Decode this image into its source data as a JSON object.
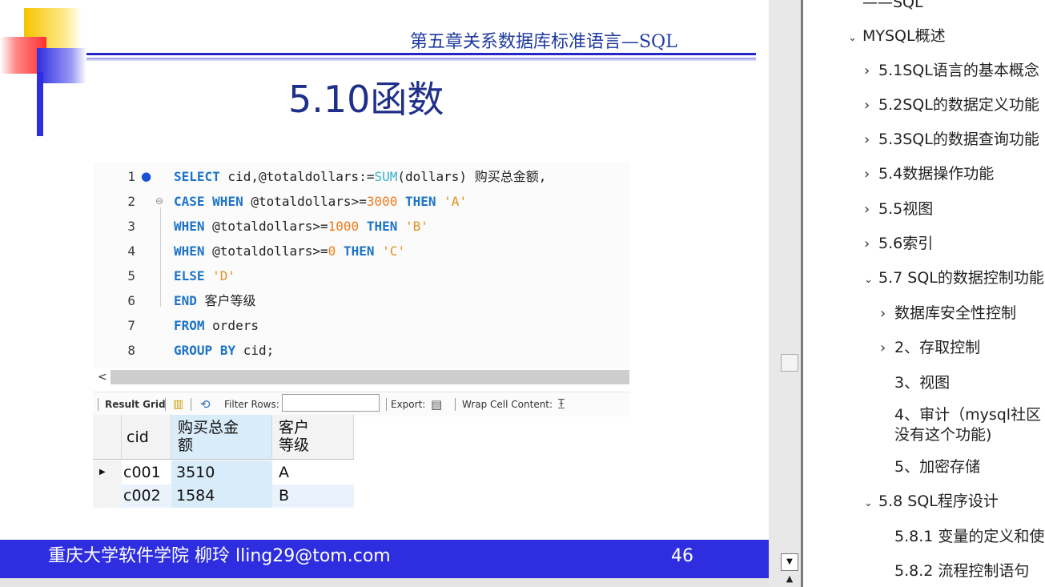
{
  "slide": {
    "chapter_title": "第五章关系数据库标准语言—SQL",
    "title": "5.10函数",
    "footer_text": "重庆大学软件学院 柳玲 lling29@tom.com",
    "page_number": "46"
  },
  "code": {
    "lines": [
      {
        "num": "1",
        "text": "SELECT cid,@totaldollars:=SUM(dollars) 购买总金额,"
      },
      {
        "num": "2",
        "text": "CASE WHEN @totaldollars>=3000 THEN 'A'"
      },
      {
        "num": "3",
        "text": "WHEN @totaldollars>=1000 THEN 'B'"
      },
      {
        "num": "4",
        "text": "WHEN @totaldollars>=0 THEN 'C'"
      },
      {
        "num": "5",
        "text": "ELSE 'D'"
      },
      {
        "num": "6",
        "text": "END 客户等级"
      },
      {
        "num": "7",
        "text": "FROM orders"
      },
      {
        "num": "8",
        "text": "GROUP BY cid;"
      }
    ]
  },
  "toolbar": {
    "result_grid_label": "Result Grid",
    "filter_rows_label": "Filter Rows:",
    "filter_rows_value": "",
    "export_label": "Export:",
    "wrap_cell_label": "Wrap Cell Content:"
  },
  "results": {
    "headers": [
      "cid",
      "购买总金额",
      "客户等级"
    ],
    "rows": [
      [
        "c001",
        "3510",
        "A"
      ],
      [
        "c002",
        "1584",
        "B"
      ]
    ]
  },
  "outline": {
    "items": [
      {
        "label": "——SQL",
        "chevron": ""
      },
      {
        "label": "MYSQL概述",
        "chevron": "expanded"
      },
      {
        "label": "5.1SQL语言的基本概念",
        "chevron": "collapsed"
      },
      {
        "label": "5.2SQL的数据定义功能",
        "chevron": "collapsed"
      },
      {
        "label": "5.3SQL的数据查询功能",
        "chevron": "collapsed"
      },
      {
        "label": "5.4数据操作功能",
        "chevron": "collapsed"
      },
      {
        "label": "5.5视图",
        "chevron": "collapsed"
      },
      {
        "label": "5.6索引",
        "chevron": "collapsed"
      },
      {
        "label": "5.7 SQL的数据控制功能",
        "chevron": "expanded"
      },
      {
        "label": "数据库安全性控制",
        "chevron": "collapsed"
      },
      {
        "label": "2、存取控制",
        "chevron": "collapsed"
      },
      {
        "label": "3、视图",
        "chevron": ""
      },
      {
        "label": "4、审计（mysql社区",
        "chevron": ""
      },
      {
        "label": "没有这个功能)",
        "chevron": ""
      },
      {
        "label": "5、加密存储",
        "chevron": ""
      },
      {
        "label": "5.8 SQL程序设计",
        "chevron": "expanded"
      },
      {
        "label": "5.8.1 变量的定义和使",
        "chevron": ""
      },
      {
        "label": "5.8.2 流程控制语句",
        "chevron": ""
      }
    ]
  },
  "colors": {
    "accent_blue": "#2e2ee0",
    "title_blue": "#1f2f8a",
    "keyword_blue": "#1d74c6",
    "number_orange": "#f07a1a"
  }
}
